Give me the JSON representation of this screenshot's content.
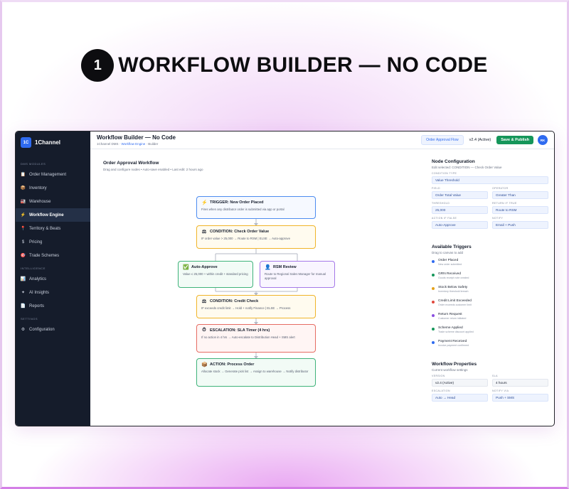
{
  "headline": {
    "step_number": "1",
    "title": "WORKFLOW BUILDER — NO CODE"
  },
  "sidebar": {
    "logo_text": "1C",
    "brand_name": "1Channel",
    "sections": [
      {
        "label": "DMS MODULES",
        "items": [
          {
            "label": "Order Management",
            "icon": "clipboard-icon"
          },
          {
            "label": "Inventory",
            "icon": "box-icon"
          },
          {
            "label": "Warehouse",
            "icon": "warehouse-icon"
          },
          {
            "label": "Workflow Engine",
            "icon": "lightning-icon",
            "active": true
          },
          {
            "label": "Territory & Beats",
            "icon": "pin-icon"
          },
          {
            "label": "Pricing",
            "icon": "dollar-icon"
          },
          {
            "label": "Trade Schemes",
            "icon": "target-icon"
          }
        ]
      },
      {
        "label": "INTELLIGENCE",
        "items": [
          {
            "label": "Analytics",
            "icon": "chart-icon"
          },
          {
            "label": "AI Insights",
            "icon": "sparkle-icon"
          },
          {
            "label": "Reports",
            "icon": "document-icon"
          }
        ]
      },
      {
        "label": "SETTINGS",
        "items": [
          {
            "label": "Configuration",
            "icon": "gear-icon"
          }
        ]
      }
    ]
  },
  "topbar": {
    "title": "Workflow Builder — No Code",
    "breadcrumb_root": "1Channel DMS",
    "breadcrumb_link": "Workflow Engine",
    "breadcrumb_leaf": "Builder",
    "flow_select": "Order Approval Flow",
    "version": "v2.4 (Active)",
    "publish_label": "Save & Publish",
    "avatar_initials": "RK"
  },
  "canvas": {
    "title": "Order Approval Workflow",
    "subtitle": "Drag and configure nodes • Auto-save enabled • Last edit: 2 hours ago",
    "nodes": {
      "trigger": {
        "title": "TRIGGER: New Order Placed",
        "desc": "Fires when any distributor order is submitted via app or portal"
      },
      "condition_value": {
        "title": "CONDITION: Check Order Value",
        "desc": "IF order value > 25,000 → Route to RSM | ELSE → Auto-approve"
      },
      "auto_approve": {
        "title": "Auto-Approve",
        "desc": "Value ≤ 25,000 + within credit + standard pricing"
      },
      "rsm_review": {
        "title": "RSM Review",
        "desc": "Route to Regional Sales Manager for manual approval"
      },
      "credit_check": {
        "title": "CONDITION: Credit Check",
        "desc": "IF exceeds credit limit → Hold + notify Finance | ELSE → Process"
      },
      "escalation": {
        "title": "ESCALATION: SLA Timer (4 hrs)",
        "desc": "If no action in 4 hrs → Auto-escalate to Distribution Head + SMS alert"
      },
      "process_order": {
        "title": "ACTION: Process Order",
        "desc": "Allocate stock → Generate pick list → Assign to warehouse → Notify distributor"
      }
    }
  },
  "node_config": {
    "title": "Node Configuration",
    "subtitle": "Edit selected: CONDITION — Check Order Value",
    "condition_type_label": "CONDITION TYPE",
    "condition_type_value": "Value Threshold",
    "field_label": "FIELD",
    "field_value": "Order Total Value",
    "operator_label": "OPERATOR",
    "operator_value": "Greater Than",
    "threshold_label": "THRESHOLD",
    "threshold_value": "25,000",
    "action_true_label": "RETURN IF TRUE",
    "action_true_value": "Route to RSM",
    "action_false_label": "ACTION IF FALSE",
    "action_false_value": "Auto-Approve",
    "notify_label": "NOTIFY",
    "notify_value": "Email + Push"
  },
  "triggers": {
    "title": "Available Triggers",
    "subtitle": "Drag to canvas to add",
    "items": [
      {
        "name": "Order Placed",
        "desc": "New order submitted",
        "color": "#2f6bf0"
      },
      {
        "name": "GRN Received",
        "desc": "Goods receipt note created",
        "color": "#15965a"
      },
      {
        "name": "Stock Below Safety",
        "desc": "Inventory threshold breach",
        "color": "#e5a21a"
      },
      {
        "name": "Credit Limit Exceeded",
        "desc": "Order exceeds customer limit",
        "color": "#e0483d"
      },
      {
        "name": "Return Request",
        "desc": "Customer return initiated",
        "color": "#8a4fe0"
      },
      {
        "name": "Scheme Applied",
        "desc": "Trade scheme discount applied",
        "color": "#15965a"
      },
      {
        "name": "Payment Received",
        "desc": "Invoice payment confirmed",
        "color": "#2f6bf0"
      }
    ]
  },
  "properties": {
    "title": "Workflow Properties",
    "subtitle": "Current workflow settings",
    "version_label": "VERSION",
    "version_value": "v2.4 (Active)",
    "sla_label": "SLA",
    "sla_value": "4 hours",
    "escalation_label": "ESCALATION",
    "escalation_value": "Auto → Head",
    "notify_label": "NOTIFY VIA",
    "notify_value": "Push + SMS"
  }
}
